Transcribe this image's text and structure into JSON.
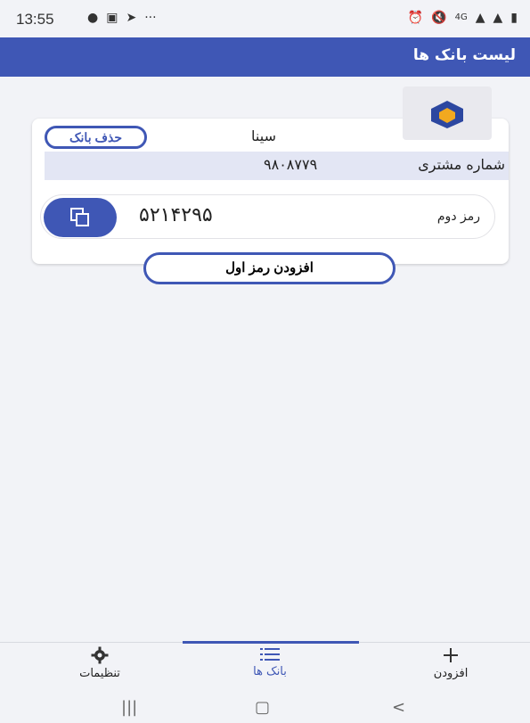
{
  "status_bar": {
    "time": "13:55",
    "left_icons": [
      "notification-badge-icon",
      "gallery-icon",
      "telegram-icon",
      "more-dots-icon"
    ],
    "right_icons": [
      "alarm-icon",
      "mute-icon",
      "network-4g-icon",
      "signal-volte-icon",
      "signal-icon",
      "battery-icon"
    ]
  },
  "app_bar": {
    "title": "لیست بانک ها"
  },
  "bank_card": {
    "delete_label": "حذف بانک",
    "bank_name": "سینا",
    "customer_label": "شماره مشتری",
    "customer_number": "۹۸۰۸۷۷۹",
    "password_label": "رمز دوم",
    "password_value": "۵۲۱۴۲۹۵"
  },
  "add_first_password_label": "افزودن رمز اول",
  "bottom_nav": {
    "settings_label": "تنظیمات",
    "banks_label": "بانک ها",
    "add_label": "افزودن"
  },
  "colors": {
    "primary": "#3f57b5",
    "background": "#f2f3f7",
    "customer_row": "#e3e6f4"
  }
}
